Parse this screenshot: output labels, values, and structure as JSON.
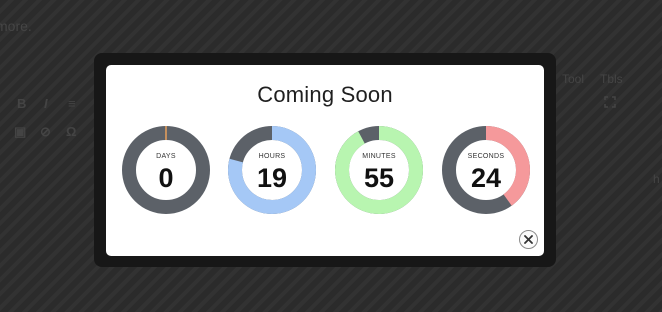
{
  "background": {
    "title_fragment": "more.",
    "menu": [
      "Tool",
      "Tbls"
    ],
    "toolbar": [
      "B",
      "I"
    ],
    "tag": "h"
  },
  "modal": {
    "title": "Coming Soon",
    "close_icon": "close-icon"
  },
  "countdown": [
    {
      "label": "DAYS",
      "value": "0",
      "fraction": 0.0,
      "color": "#e8a15a",
      "track": "#5c6168"
    },
    {
      "label": "HOURS",
      "value": "19",
      "fraction": 0.79,
      "color": "#a5c8f6",
      "track": "#5c6168"
    },
    {
      "label": "MINUTES",
      "value": "55",
      "fraction": 0.92,
      "color": "#b8f5b0",
      "track": "#5c6168"
    },
    {
      "label": "SECONDS",
      "value": "24",
      "fraction": 0.4,
      "color": "#f5999b",
      "track": "#5c6168"
    }
  ]
}
